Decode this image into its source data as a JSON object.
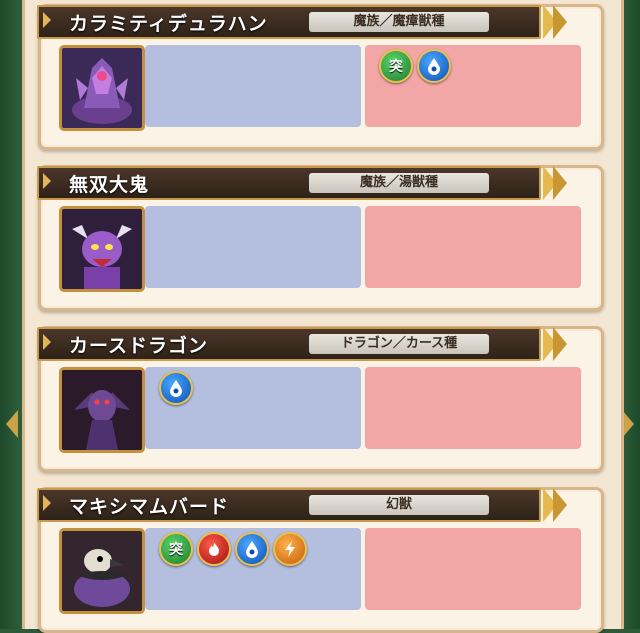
{
  "monsters": [
    {
      "name": "カラミティデュラハン",
      "family": "魔族／魔瘴獣種",
      "blue_icons": [],
      "pink_icons": [
        "toku-icon",
        "water-icon"
      ]
    },
    {
      "name": "無双大鬼",
      "family": "魔族／湯獣種",
      "blue_icons": [],
      "pink_icons": []
    },
    {
      "name": "カースドラゴン",
      "family": "ドラゴン／カース種",
      "blue_icons": [
        "water-icon"
      ],
      "pink_icons": []
    },
    {
      "name": "マキシマムバード",
      "family": "幻獣",
      "blue_icons": [
        "toku-icon",
        "fire-icon",
        "water-icon",
        "thunder-icon"
      ],
      "pink_icons": []
    }
  ],
  "icon_glyphs": {
    "toku-icon": "突"
  },
  "colors": {
    "banner": "#3a2a1f",
    "blue_box": "#b4bede",
    "pink_box": "#f3a6a6",
    "gold": "#e6b94f"
  }
}
